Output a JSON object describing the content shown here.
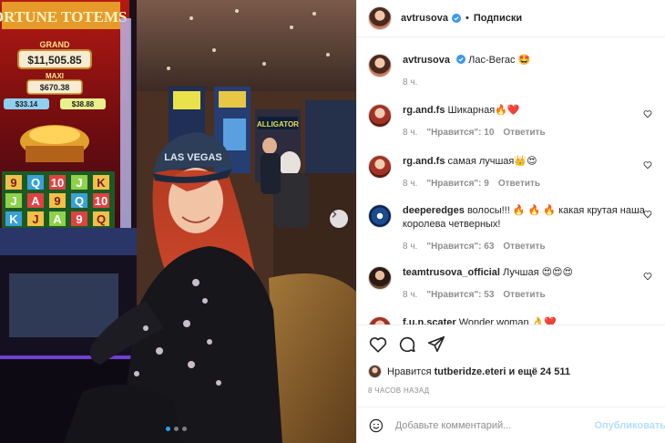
{
  "post": {
    "author": "avtrusova",
    "follow_label": "Подписки",
    "separator": "•"
  },
  "photo": {
    "slot_text_top": "FORTUNE TOTEMS",
    "grand_label": "GRAND",
    "grand_value": "$11,505.85",
    "maxi_label": "MAXI",
    "maxi_value": "$670.38",
    "mini_value": "$33.14",
    "minor_value": "$38.88",
    "cap_text": "LAS VEGAS",
    "sign_text": "ALLIGATOR",
    "active_slide": 1,
    "slide_count": 3
  },
  "comments": [
    {
      "username": "avtrusova",
      "text": "Лас-Вегас 🤩",
      "time": "8 ч.",
      "likes_label": "",
      "reply_label": "",
      "verified": true
    },
    {
      "username": "rg.and.fs",
      "text": "Шикарная🔥❤️",
      "time": "8 ч.",
      "likes_label": "\"Нравится\": 10",
      "reply_label": "Ответить"
    },
    {
      "username": "rg.and.fs",
      "text": "самая лучшая👑😍",
      "time": "8 ч.",
      "likes_label": "\"Нравится\": 9",
      "reply_label": "Ответить"
    },
    {
      "username": "deeperedges",
      "text": "волосы!!! 🔥 🔥 🔥 какая крутая наша королева четверных!",
      "time": "8 ч.",
      "likes_label": "\"Нравится\": 63",
      "reply_label": "Ответить"
    },
    {
      "username": "teamtrusova_official",
      "text": "Лучшая 😍😍😍",
      "time": "8 ч.",
      "likes_label": "\"Нравится\": 53",
      "reply_label": "Ответить"
    },
    {
      "username": "f.u.n.scater",
      "text": "Wonder woman 👌❤️",
      "time": "",
      "likes_label": "",
      "reply_label": ""
    }
  ],
  "likes": {
    "prefix": "Нравится",
    "user": "tutberidze.eteri",
    "suffix": "и ещё 24 511"
  },
  "timestamp": "8 часов назад",
  "comment_input": {
    "placeholder": "Добавьте комментарий...",
    "submit_label": "Опубликовать"
  },
  "colors": {
    "verified": "#3897f0",
    "submit_disabled": "#b2dffc",
    "muted": "#8e8e8e"
  }
}
